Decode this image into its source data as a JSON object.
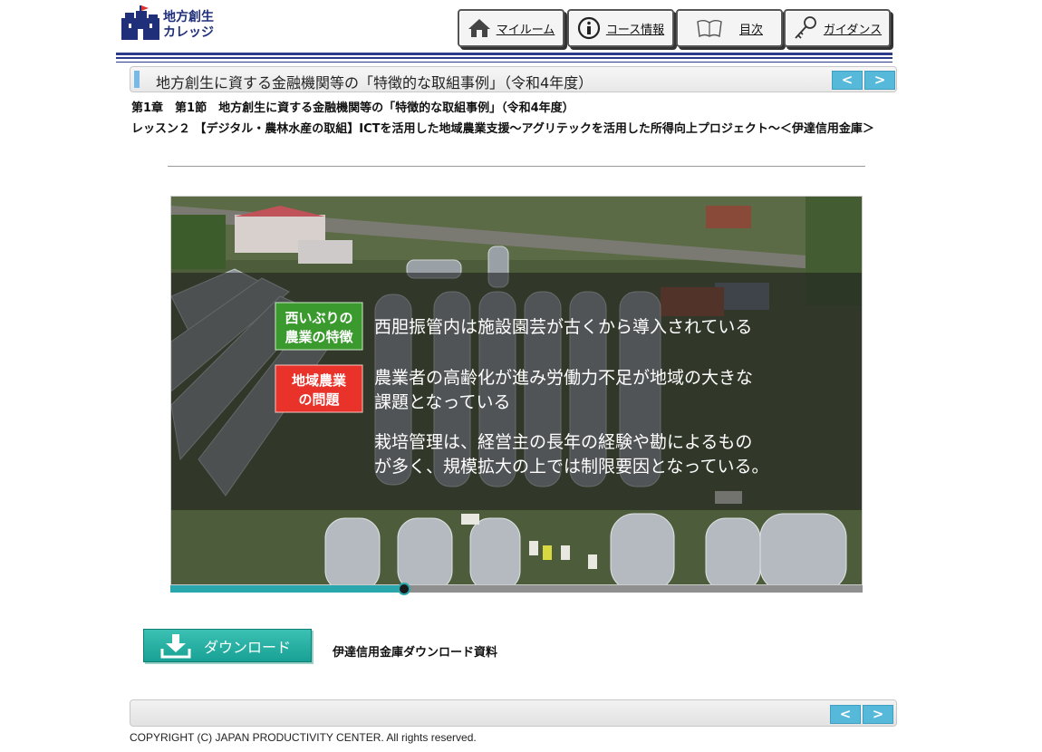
{
  "header": {
    "logo_line1": "地方創生",
    "logo_line2": "カレッジ",
    "nav": [
      {
        "label": "マイルーム",
        "icon": "home-icon"
      },
      {
        "label": "コース情報",
        "icon": "info-icon"
      },
      {
        "label": "目次",
        "icon": "book-icon"
      },
      {
        "label": "ガイダンス",
        "icon": "key-icon"
      }
    ]
  },
  "course": {
    "title": "地方創生に資する金融機関等の「特徴的な取組事例」（令和4年度）",
    "prev_label": "<",
    "next_label": ">",
    "chapter": "第1章　第1節　地方創生に資する金融機関等の「特徴的な取組事例」（令和4年度）",
    "lesson": "レッスン２ 【デジタル・農林水産の取組】ICTを活用した地域農業支援～アグリテックを活用した所得向上プロジェクト～＜伊達信用金庫＞"
  },
  "video": {
    "badges": [
      {
        "line1": "西いぶりの",
        "line2": "農業の特徴",
        "color": "#3a9a2e"
      },
      {
        "line1": "地域農業",
        "line2": "の問題",
        "color": "#e8322a"
      }
    ],
    "lines": [
      "西胆振管内は施設園芸が古くから導入されている",
      "農業者の高齢化が進み労働力不足が地域の大きな",
      "課題となっている",
      "栽培管理は、経営主の長年の経験や勘によるもの",
      "が多く、規模拡大の上では制限要因となっている。"
    ],
    "progress": 0.338
  },
  "download": {
    "button_label": "ダウンロード",
    "description": "伊達信用金庫ダウンロード資料"
  },
  "footer": {
    "prev_label": "<",
    "next_label": ">",
    "copyright": "COPYRIGHT (C) JAPAN PRODUCTIVITY CENTER. All rights reserved."
  },
  "colors": {
    "brand": "#2c3a8c",
    "accent": "#57b9da",
    "progress": "#2aa6ad",
    "download": "#17a194"
  }
}
